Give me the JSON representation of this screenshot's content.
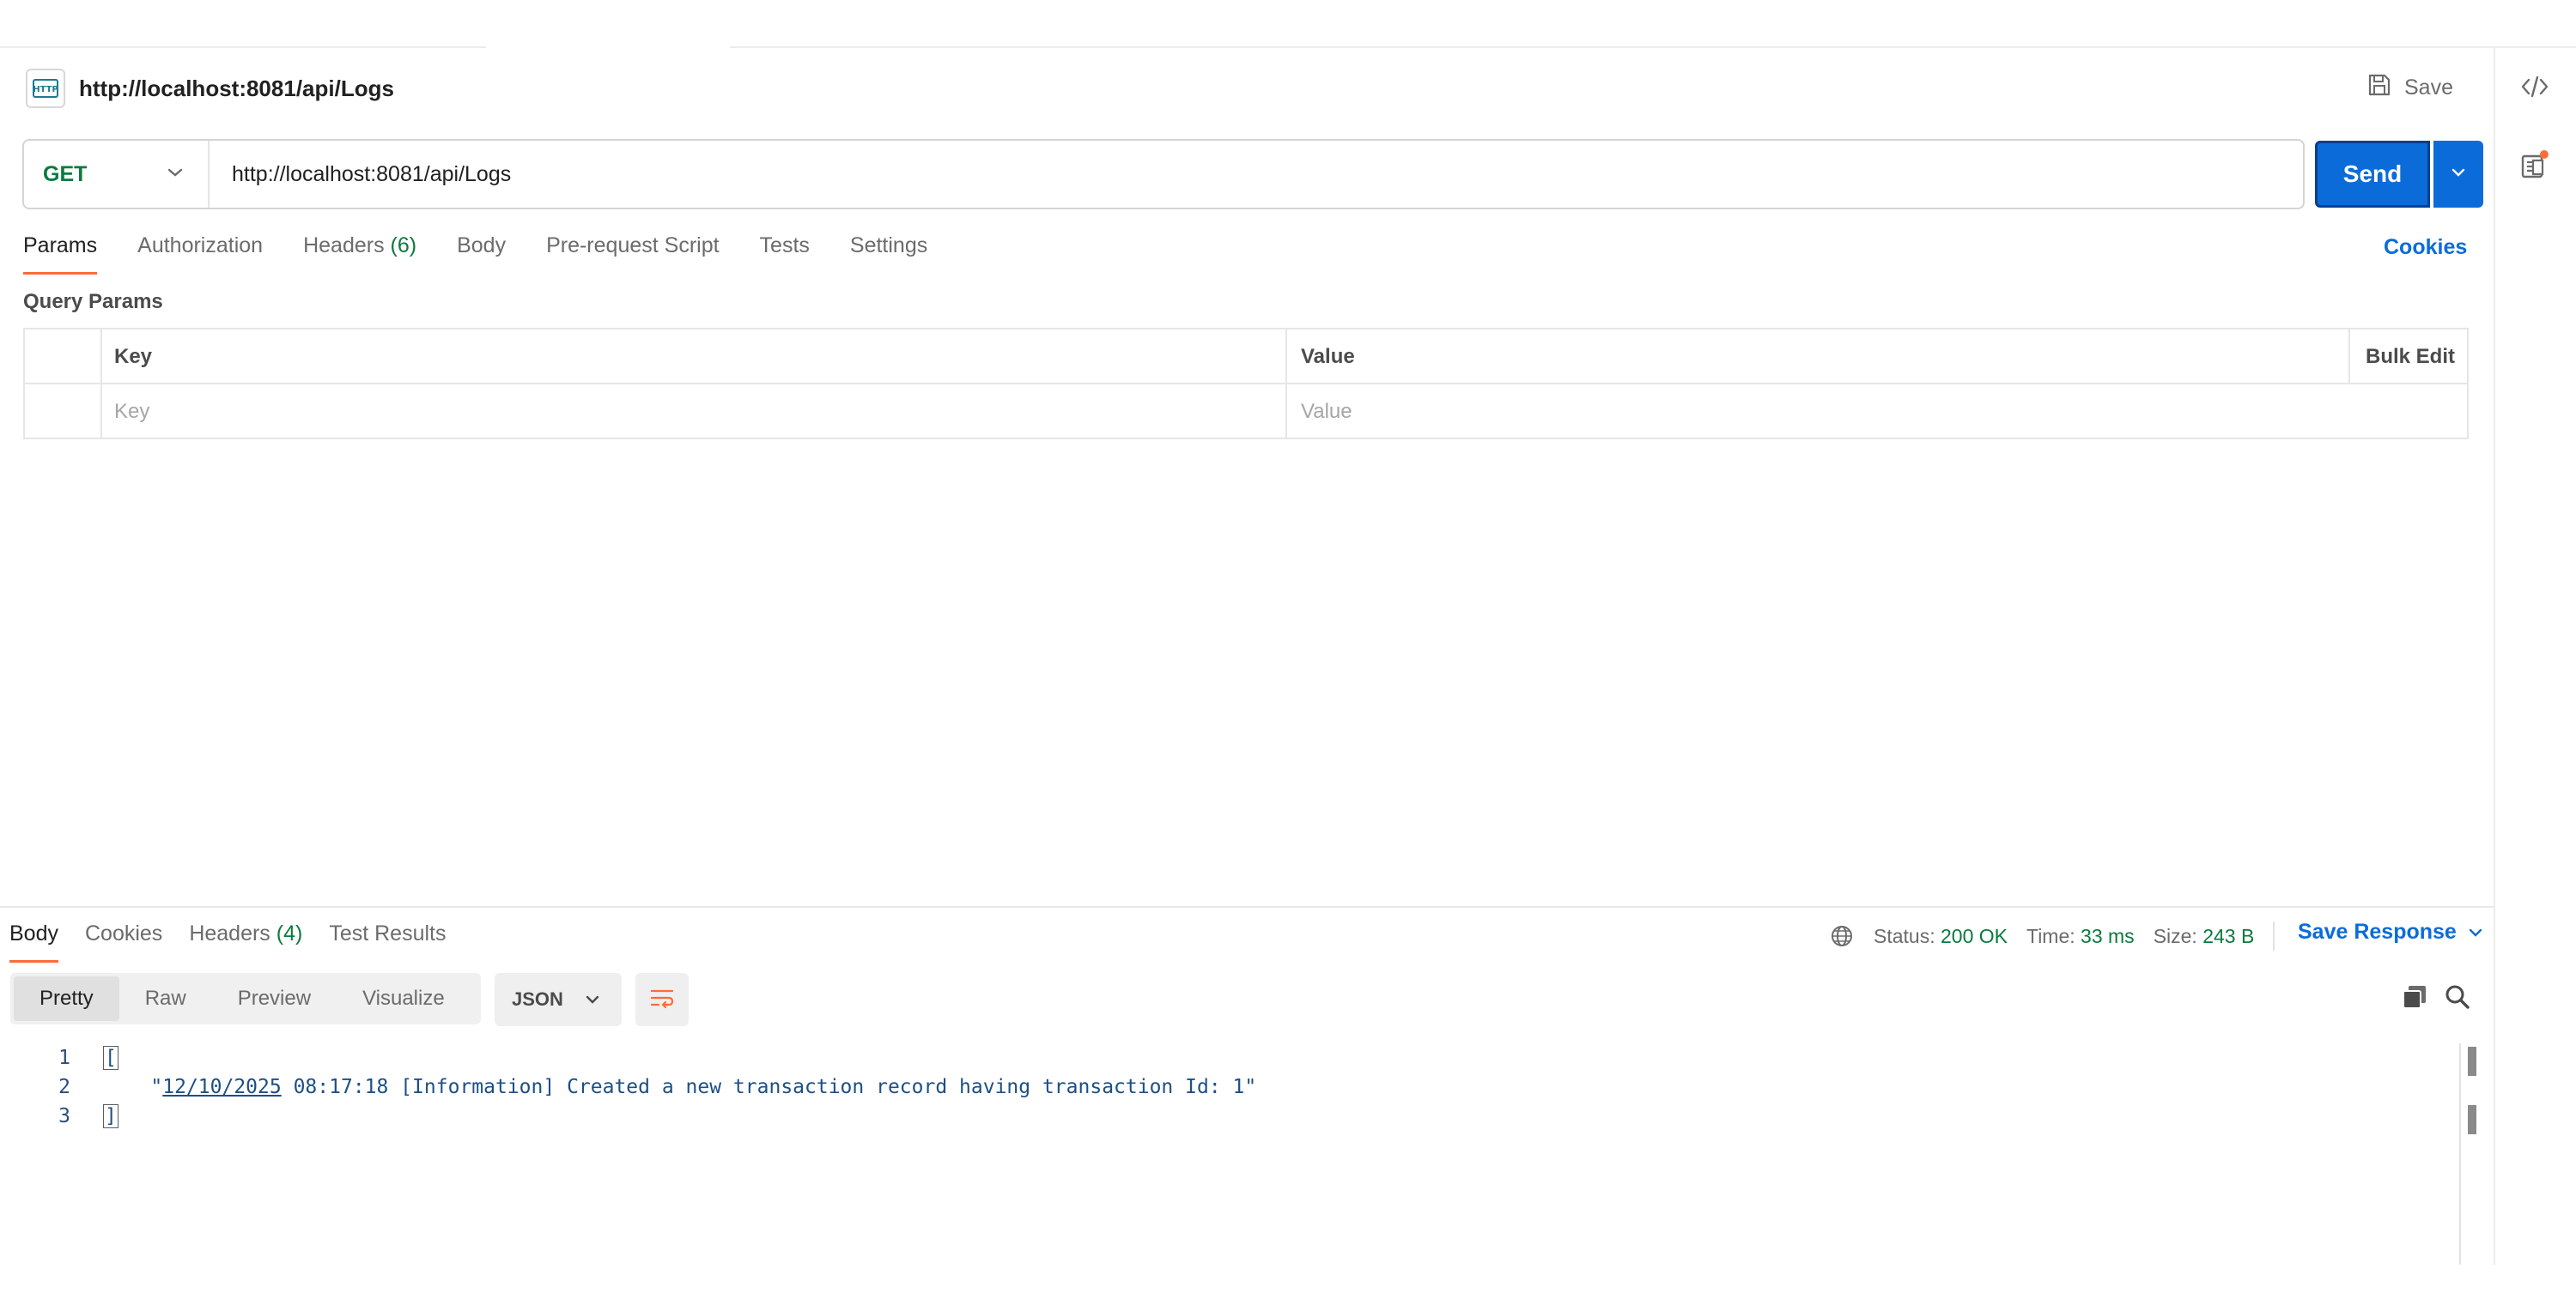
{
  "request": {
    "title": "http://localhost:8081/api/Logs",
    "save_label": "Save",
    "method": "GET",
    "url": "http://localhost:8081/api/Logs",
    "send_label": "Send"
  },
  "request_tabs": {
    "params": "Params",
    "authorization": "Authorization",
    "headers": "Headers",
    "headers_count": "(6)",
    "body": "Body",
    "prerequest": "Pre-request Script",
    "tests": "Tests",
    "settings": "Settings",
    "cookies": "Cookies"
  },
  "query_params": {
    "title": "Query Params",
    "col_key": "Key",
    "col_value": "Value",
    "bulk_edit": "Bulk Edit",
    "key_placeholder": "Key",
    "value_placeholder": "Value"
  },
  "response_tabs": {
    "body": "Body",
    "cookies": "Cookies",
    "headers": "Headers",
    "headers_count": "(4)",
    "test_results": "Test Results"
  },
  "response_meta": {
    "status_label": "Status:",
    "status_value": "200 OK",
    "time_label": "Time:",
    "time_value": "33 ms",
    "size_label": "Size:",
    "size_value": "243 B",
    "save_response": "Save Response"
  },
  "view_modes": {
    "pretty": "Pretty",
    "raw": "Raw",
    "preview": "Preview",
    "visualize": "Visualize",
    "format": "JSON"
  },
  "code": {
    "lines": [
      {
        "num": "1",
        "text": "["
      },
      {
        "num": "2",
        "indent": "    \"",
        "date": "12/10/2025",
        "rest": " 08:17:18 [Information] Created a new transaction record having transaction Id: 1\""
      },
      {
        "num": "3",
        "text": "]"
      }
    ]
  },
  "colors": {
    "accent": "#ff6c37",
    "primary": "#0b6cd9",
    "success": "#0b7a3e"
  }
}
